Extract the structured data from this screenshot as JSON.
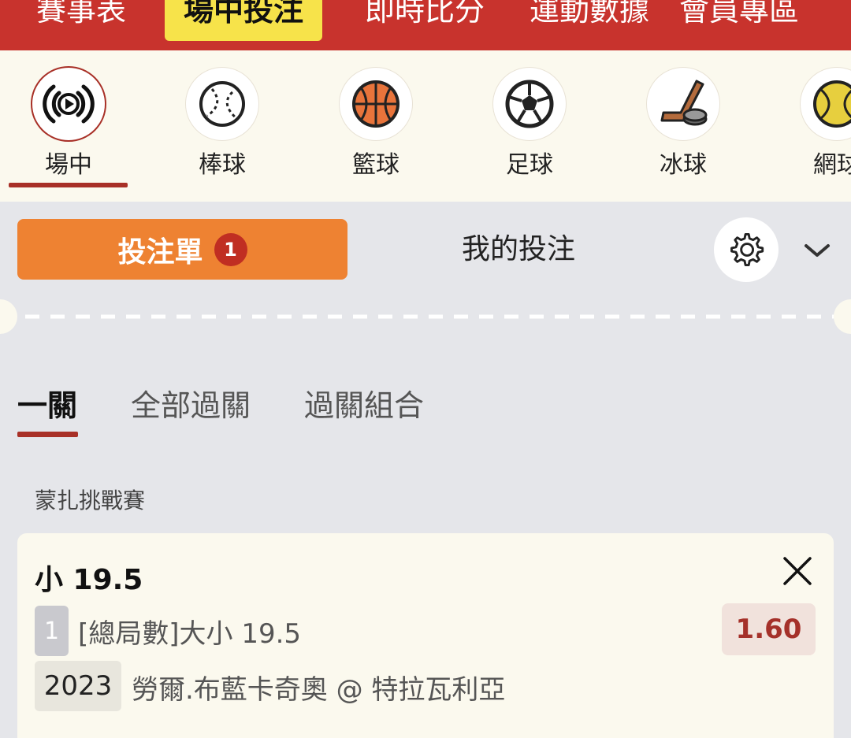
{
  "topnav": {
    "tabs": [
      {
        "label": "賽事表"
      },
      {
        "label": "場中投注"
      },
      {
        "label": "即時比分"
      },
      {
        "label": "運動數據"
      },
      {
        "label": "會員專區"
      }
    ],
    "active_index": 1
  },
  "sports": [
    {
      "label": "場中",
      "icon": "live-broadcast-icon"
    },
    {
      "label": "棒球",
      "icon": "baseball-icon"
    },
    {
      "label": "籃球",
      "icon": "basketball-icon"
    },
    {
      "label": "足球",
      "icon": "soccer-ball-icon"
    },
    {
      "label": "冰球",
      "icon": "ice-hockey-icon"
    },
    {
      "label": "網球",
      "icon": "tennis-ball-icon"
    }
  ],
  "panel": {
    "betslip_label": "投注單",
    "betslip_count": "1",
    "mybets_label": "我的投注"
  },
  "subtabs": [
    {
      "label": "一關"
    },
    {
      "label": "全部過關"
    },
    {
      "label": "過關組合"
    }
  ],
  "league": "蒙扎挑戰賽",
  "bet": {
    "selection": "小 19.5",
    "number": "1",
    "market": "[總局數]大小 19.5",
    "odds": "1.60",
    "year": "2023",
    "event": "勞爾.布藍卡奇奧 @ 特拉瓦利亞"
  },
  "colors": {
    "brand_red": "#c8332d",
    "highlight_yellow": "#f7e34a",
    "betslip_orange": "#ee8232",
    "accent_dark_red": "#a83027"
  }
}
